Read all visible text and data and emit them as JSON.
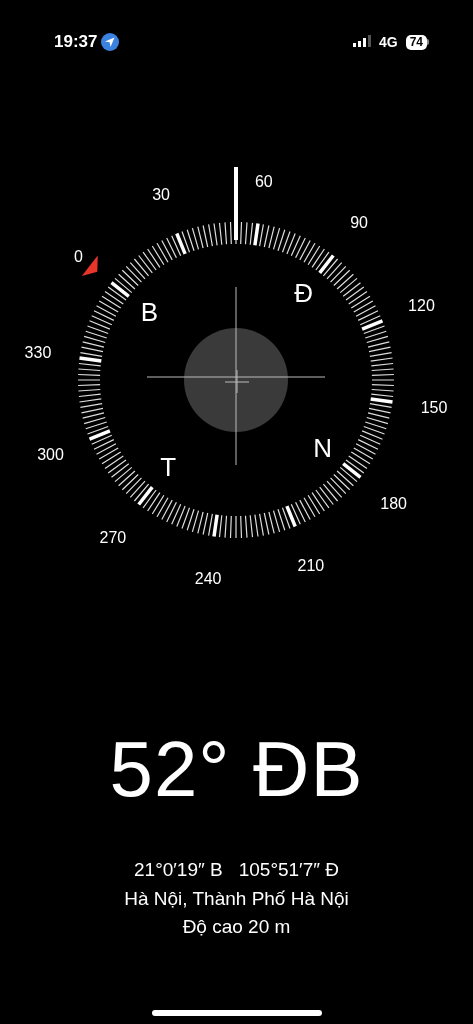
{
  "status_bar": {
    "time": "19:37",
    "network": "4G",
    "battery": "74"
  },
  "compass": {
    "degree_labels": [
      "0",
      "30",
      "60",
      "90",
      "120",
      "150",
      "180",
      "210",
      "240",
      "270",
      "300",
      "330"
    ],
    "cardinals": [
      "B",
      "Đ",
      "N",
      "T"
    ]
  },
  "heading": "52° ĐB",
  "coordinates": [
    "21°0′19″ B",
    "105°51′7″ Đ"
  ],
  "location": "Hà Nội, Thành Phố Hà Nội",
  "elevation": "Độ cao 20 m"
}
